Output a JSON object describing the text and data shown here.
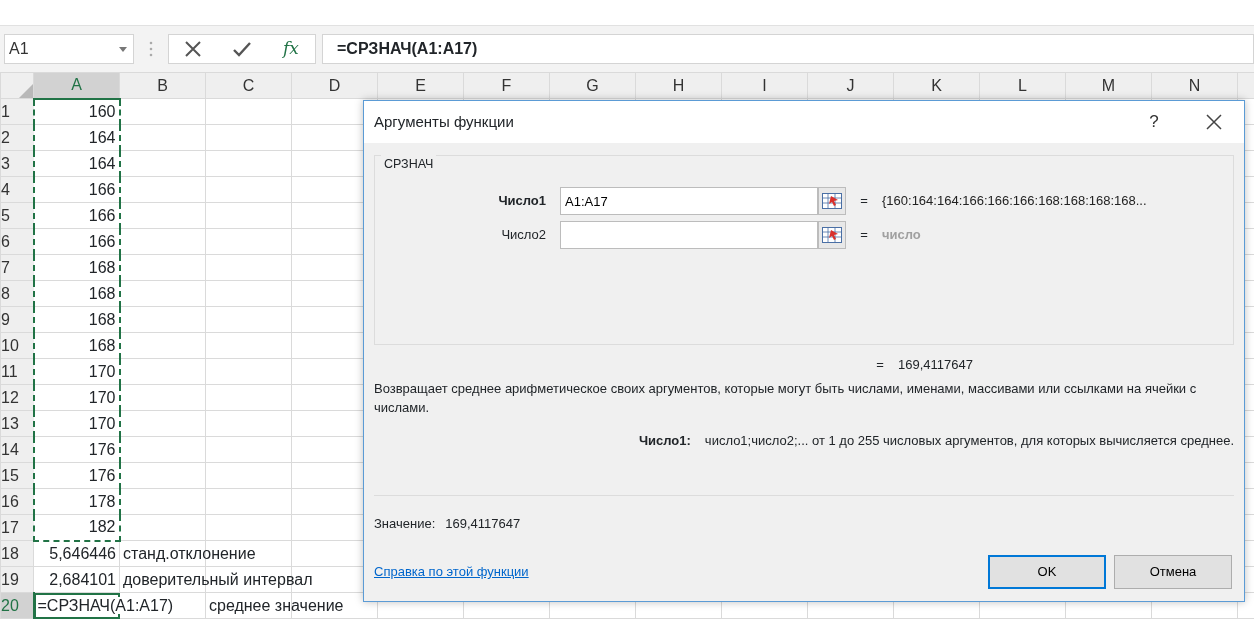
{
  "name_box": {
    "value": "A1"
  },
  "formula_bar": {
    "function_label": "fx",
    "formula": "=СРЗНАЧ(A1:A17)"
  },
  "columns": [
    {
      "label": "A",
      "selected": true
    },
    {
      "label": "B",
      "selected": false
    },
    {
      "label": "C",
      "selected": false
    },
    {
      "label": "D",
      "selected": false
    },
    {
      "label": "E",
      "selected": false
    },
    {
      "label": "F",
      "selected": false
    },
    {
      "label": "G",
      "selected": false
    },
    {
      "label": "H",
      "selected": false
    },
    {
      "label": "I",
      "selected": false
    },
    {
      "label": "J",
      "selected": false
    },
    {
      "label": "K",
      "selected": false
    },
    {
      "label": "L",
      "selected": false
    },
    {
      "label": "M",
      "selected": false
    },
    {
      "label": "N",
      "selected": false
    }
  ],
  "rows": [
    {
      "number": "1",
      "selected": false,
      "marquee": true,
      "a": "160"
    },
    {
      "number": "2",
      "selected": false,
      "marquee": true,
      "a": "164"
    },
    {
      "number": "3",
      "selected": false,
      "marquee": true,
      "a": "164"
    },
    {
      "number": "4",
      "selected": false,
      "marquee": true,
      "a": "166"
    },
    {
      "number": "5",
      "selected": false,
      "marquee": true,
      "a": "166"
    },
    {
      "number": "6",
      "selected": false,
      "marquee": true,
      "a": "166"
    },
    {
      "number": "7",
      "selected": false,
      "marquee": true,
      "a": "168"
    },
    {
      "number": "8",
      "selected": false,
      "marquee": true,
      "a": "168"
    },
    {
      "number": "9",
      "selected": false,
      "marquee": true,
      "a": "168"
    },
    {
      "number": "10",
      "selected": false,
      "marquee": true,
      "a": "168"
    },
    {
      "number": "11",
      "selected": false,
      "marquee": true,
      "a": "170"
    },
    {
      "number": "12",
      "selected": false,
      "marquee": true,
      "a": "170"
    },
    {
      "number": "13",
      "selected": false,
      "marquee": true,
      "a": "170"
    },
    {
      "number": "14",
      "selected": false,
      "marquee": true,
      "a": "176"
    },
    {
      "number": "15",
      "selected": false,
      "marquee": true,
      "a": "176"
    },
    {
      "number": "16",
      "selected": false,
      "marquee": true,
      "a": "178"
    },
    {
      "number": "17",
      "selected": false,
      "marquee": true,
      "a": "182"
    },
    {
      "number": "18",
      "selected": false,
      "marquee": false,
      "a": "5,646446",
      "b": "станд.отклонение"
    },
    {
      "number": "19",
      "selected": false,
      "marquee": false,
      "a": "2,684101",
      "b": "доверительный интервал"
    },
    {
      "number": "20",
      "selected": true,
      "marquee": false,
      "a": "=СРЗНАЧ(A1:A17)",
      "c": "среднее значение"
    }
  ],
  "dialog": {
    "title": "Аргументы функции",
    "help": "?",
    "group": "СРЗНАЧ",
    "arguments": [
      {
        "label": "Число1",
        "active": true,
        "value": "A1:A17",
        "equals": "=",
        "result": "{160:164:164:166:166:166:168:168:168:168...",
        "muted": false
      },
      {
        "label": "Число2",
        "active": false,
        "equals": "=",
        "result": "число",
        "muted": true
      }
    ],
    "formula_result": {
      "equals": "=",
      "value": "169,4117647"
    },
    "description": "Возвращает среднее арифметическое своих аргументов, которые могут быть числами, именами, массивами или ссылками на ячейки с числами.",
    "argument_help": {
      "label": "Число1:",
      "text": "число1;число2;... от 1 до 255 числовых аргументов, для которых вычисляется среднее."
    },
    "value_label": "Значение:",
    "value": "169,4117647",
    "help_link": "Справка по этой функции",
    "buttons": [
      {
        "label": "OK",
        "default": true
      },
      {
        "label": "Отмена",
        "default": false
      }
    ]
  }
}
